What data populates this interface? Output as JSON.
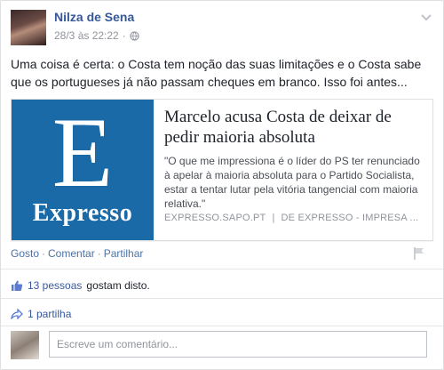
{
  "post": {
    "author": "Nilza de Sena",
    "timestamp": "28/3 às 22:22",
    "meta_separator": "·",
    "privacy_icon": "globe-icon",
    "text": "Uma coisa é certa: o Costa tem noção das suas limitações e o Costa sabe que os portugueses já não passam cheques em branco. Isso foi antes...",
    "link": {
      "thumb_letter": "E",
      "thumb_brand": "Expresso",
      "title": "Marcelo acusa Costa de deixar de pedir maioria absoluta",
      "description": "\"O que me impressiona é o líder do PS ter renunciado à apelar à maioria absoluta para o Partido Socialista, estar a tentar lutar pela vitória tangencial com maioria relativa.\"",
      "source": "EXPRESSO.SAPO.PT",
      "source_separator": "|",
      "source_author": "DE EXPRESSO - IMPRESA ..."
    },
    "actions": {
      "like": "Gosto",
      "comment": "Comentar",
      "share": "Partilhar",
      "separator": "·"
    },
    "likes": {
      "count_text": "13 pessoas",
      "suffix": "gostam disto."
    },
    "shares": {
      "text": "1 partilha"
    },
    "comment_input": {
      "placeholder": "Escreve um comentário..."
    }
  },
  "colors": {
    "link_blue": "#365899",
    "expresso_blue": "#1a6aa8"
  }
}
